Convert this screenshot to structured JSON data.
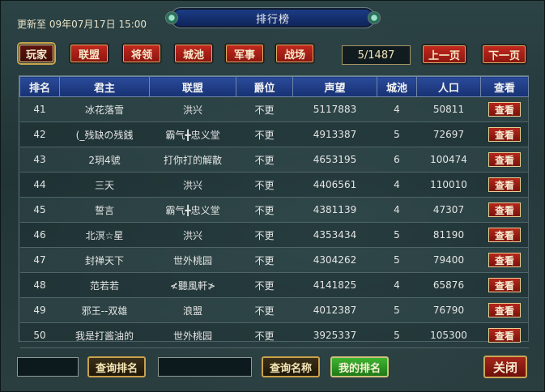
{
  "header": {
    "update_time": "更新至 09年07月17日 15:00",
    "title": "排行榜"
  },
  "tabs": [
    {
      "label": "玩家",
      "active": true
    },
    {
      "label": "联盟",
      "active": false
    },
    {
      "label": "将领",
      "active": false
    },
    {
      "label": "城池",
      "active": false
    },
    {
      "label": "军事",
      "active": false
    },
    {
      "label": "战场",
      "active": false
    }
  ],
  "pagination": {
    "page_indicator": "5/1487",
    "prev_label": "上一页",
    "next_label": "下一页"
  },
  "table": {
    "columns": [
      "排名",
      "君主",
      "联盟",
      "爵位",
      "声望",
      "城池",
      "人口",
      "查看"
    ],
    "rows": [
      [
        "41",
        "冰花落雪",
        "洪兴",
        "不更",
        "5117883",
        "4",
        "50811",
        "查看"
      ],
      [
        "42",
        "(_残缺の残銭",
        "霸气╋忠义堂",
        "不更",
        "4913387",
        "5",
        "72697",
        "查看"
      ],
      [
        "43",
        "2玥4號",
        "打你打的解散",
        "不更",
        "4653195",
        "6",
        "100474",
        "查看"
      ],
      [
        "44",
        "三天",
        "洪兴",
        "不更",
        "4406561",
        "4",
        "110010",
        "查看"
      ],
      [
        "45",
        "誓言",
        "霸气╋忠义堂",
        "不更",
        "4381139",
        "4",
        "47307",
        "查看"
      ],
      [
        "46",
        "北溟☆星",
        "洪兴",
        "不更",
        "4353434",
        "5",
        "81190",
        "查看"
      ],
      [
        "47",
        "封禅天下",
        "世外桃园",
        "不更",
        "4304262",
        "5",
        "79400",
        "查看"
      ],
      [
        "48",
        "范若若",
        "≮聽風軒≯",
        "不更",
        "4141825",
        "4",
        "65876",
        "查看"
      ],
      [
        "49",
        "邪王--双雄",
        "浪盟",
        "不更",
        "4012387",
        "5",
        "76790",
        "查看"
      ],
      [
        "50",
        "我是打酱油的",
        "世外桃园",
        "不更",
        "3925337",
        "5",
        "105300",
        "查看"
      ]
    ]
  },
  "footer": {
    "query_rank_label": "查询排名",
    "query_name_label": "查询名称",
    "my_rank_label": "我的排名",
    "close_label": "关闭"
  }
}
